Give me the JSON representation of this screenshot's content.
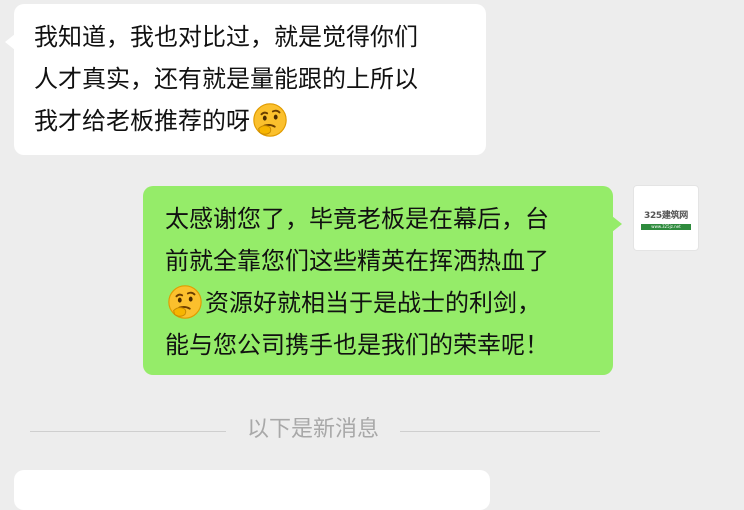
{
  "messages": [
    {
      "direction": "incoming",
      "lines": [
        "我知道，我也对比过，就是觉得你们",
        "人才真实，还有就是量能跟的上所以",
        "我才给老板推荐的呀"
      ],
      "emoji": "thinking-face"
    },
    {
      "direction": "outgoing",
      "line1": "太感谢您了，毕竟老板是在幕后，台",
      "line2": "前就全靠您们这些精英在挥洒热血了",
      "emoji": "thinking-face",
      "line3_after_emoji": "资源好就相当于是战士的利剑，",
      "line4": "能与您公司携手也是我们的荣幸呢！",
      "avatar": {
        "logo_text": "325建筑网",
        "strip_text": "www.325jz.net"
      }
    }
  ],
  "divider": {
    "label": "以下是新消息"
  },
  "colors": {
    "background": "#ededed",
    "incoming_bubble": "#ffffff",
    "outgoing_bubble": "#95ec69",
    "divider_text": "#a8a8a8"
  }
}
